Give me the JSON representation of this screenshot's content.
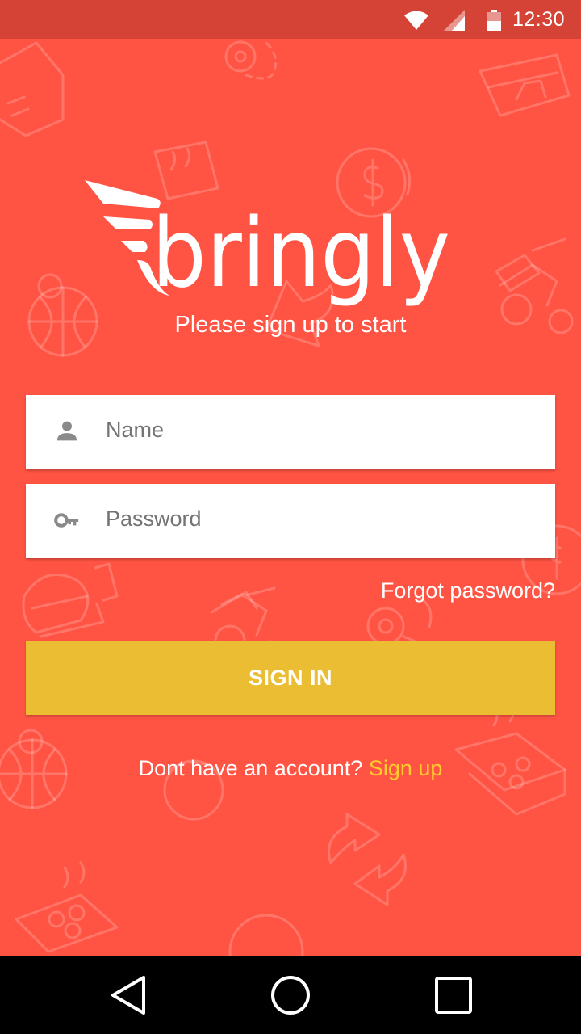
{
  "status_bar": {
    "time": "12:30"
  },
  "colors": {
    "background": "#FF5444",
    "status_bar": "#D44335",
    "button": "#EABD33",
    "link": "#FFCB2E"
  },
  "logo_text": "bringly",
  "subtitle": "Please sign up to start",
  "form": {
    "name": {
      "placeholder": "Name",
      "icon": "person-icon"
    },
    "password": {
      "placeholder": "Password",
      "icon": "key-icon"
    },
    "forgot_password": "Forgot password?",
    "submit_label": "SIGN IN"
  },
  "signup": {
    "prompt": "Dont have an account?",
    "link_label": "Sign up"
  },
  "nav_bar": {
    "icons": [
      "back-icon",
      "home-icon",
      "recents-icon"
    ]
  }
}
